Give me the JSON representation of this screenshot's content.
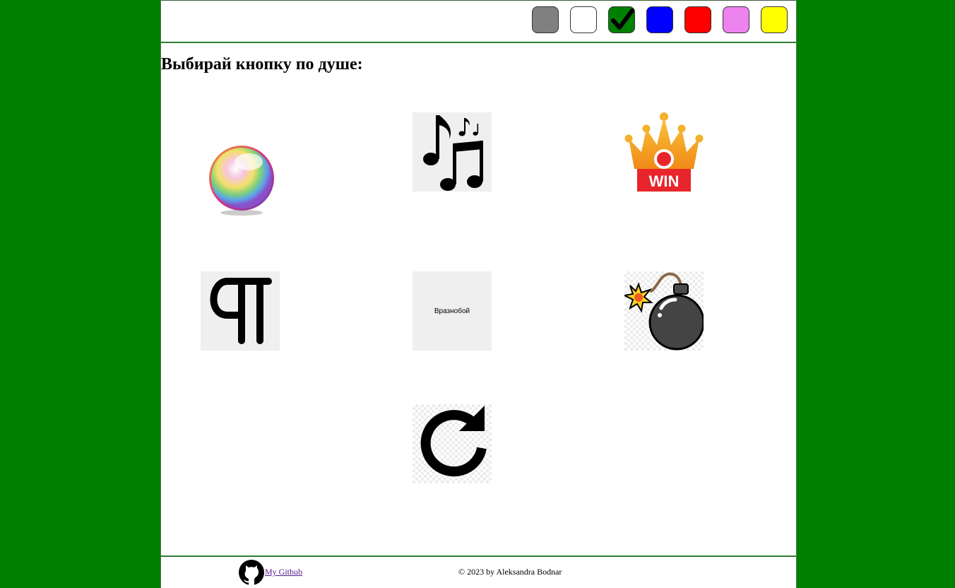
{
  "palette": {
    "swatches": [
      {
        "name": "gray",
        "color": "#808080",
        "selected": false
      },
      {
        "name": "white",
        "color": "#ffffff",
        "selected": false
      },
      {
        "name": "green",
        "color": "#008000",
        "selected": true
      },
      {
        "name": "blue",
        "color": "#0000ff",
        "selected": false
      },
      {
        "name": "red",
        "color": "#ff0000",
        "selected": false
      },
      {
        "name": "violet",
        "color": "#ee82ee",
        "selected": false
      },
      {
        "name": "yellow",
        "color": "#ffff00",
        "selected": false
      }
    ],
    "selected_icon": "check-icon"
  },
  "main": {
    "heading": "Выбирай кнопку по душе:",
    "buttons": [
      {
        "icon": "color-ball-icon"
      },
      {
        "icon": "music-notes-icon"
      },
      {
        "icon": "crown-win-icon",
        "text": "WIN"
      },
      {
        "icon": "pilcrow-icon"
      },
      {
        "icon": "text-button",
        "text": "Вразнобой"
      },
      {
        "icon": "bomb-icon"
      },
      {
        "icon": "reload-icon"
      }
    ]
  },
  "footer": {
    "github_icon": "github-icon",
    "github_link": "My Github",
    "copyright": "© 2023 by Aleksandra Bodnar"
  },
  "colors": {
    "background": "#008000",
    "page": "#ffffff",
    "divider": "#2e7d32",
    "crown": "#f5a623",
    "win_banner": "#e8252b"
  }
}
